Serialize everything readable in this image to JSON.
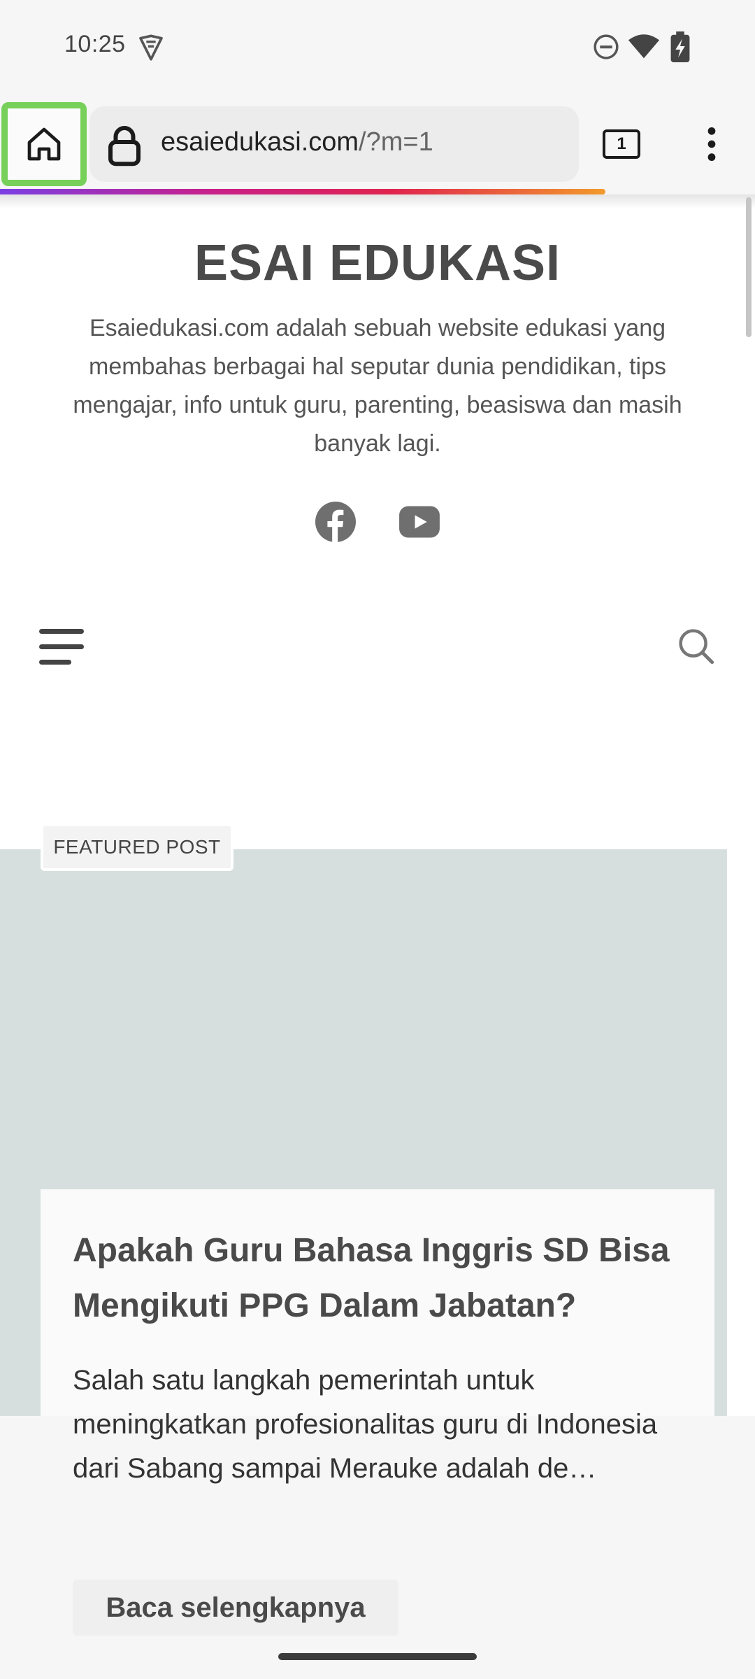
{
  "status_bar": {
    "time": "10:25",
    "icons": [
      "vpn-key-icon",
      "do-not-disturb-icon",
      "wifi-icon",
      "battery-charging-icon"
    ]
  },
  "browser": {
    "home_icon": "home-icon",
    "lock_icon": "lock-icon",
    "url_host": "esaiedukasi.com",
    "url_path": "/?m=1",
    "tab_count": "1",
    "menu_icon": "more-vert-icon",
    "highlight_color": "#76d05a"
  },
  "site": {
    "title": "ESAI EDUKASI",
    "description": "Esaiedukasi.com adalah sebuah website edukasi yang membahas berbagai hal seputar dunia pendidikan, tips mengajar, info untuk guru, parenting, beasiswa dan masih banyak lagi.",
    "social_icons": [
      "facebook-icon",
      "youtube-icon"
    ],
    "nav_icons": [
      "hamburger-menu-icon",
      "search-icon"
    ]
  },
  "featured": {
    "badge": "FEATURED POST",
    "post_title": "Apakah Guru Bahasa Inggris SD Bisa Mengikuti PPG Dalam Jabatan?",
    "excerpt": "Salah satu langkah pemerintah untuk meningkatkan profesionalitas guru di Indonesia dari Sabang sampai Merauke adalah de…",
    "read_more": "Baca selengkapnya"
  }
}
